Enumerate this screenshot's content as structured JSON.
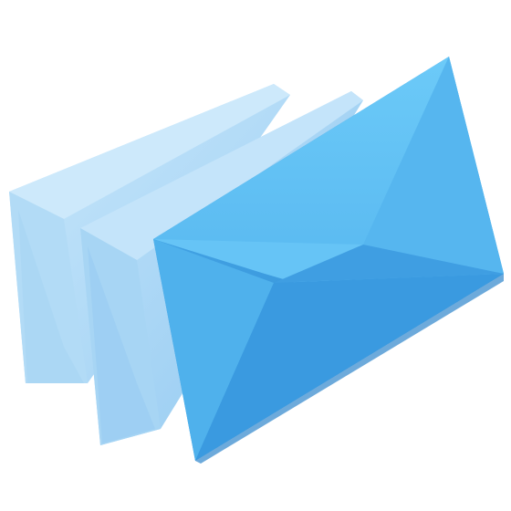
{
  "icon": {
    "name": "stacked-envelopes-icon",
    "layers": [
      {
        "name": "back-envelope",
        "color_light": "#bfe3fa",
        "color_mid": "#a9d6f5",
        "color_dark": "#95cbef"
      },
      {
        "name": "middle-envelope",
        "color_light": "#b3dcf8",
        "color_mid": "#9fd0f3",
        "color_dark": "#8cc5ee"
      },
      {
        "name": "front-envelope",
        "color_top": "#62c1f6",
        "color_left": "#4dafea",
        "color_right": "#3f9ddf",
        "color_bottom": "#3492d8",
        "color_flap_shadow": "#3aa3e6"
      }
    ]
  }
}
